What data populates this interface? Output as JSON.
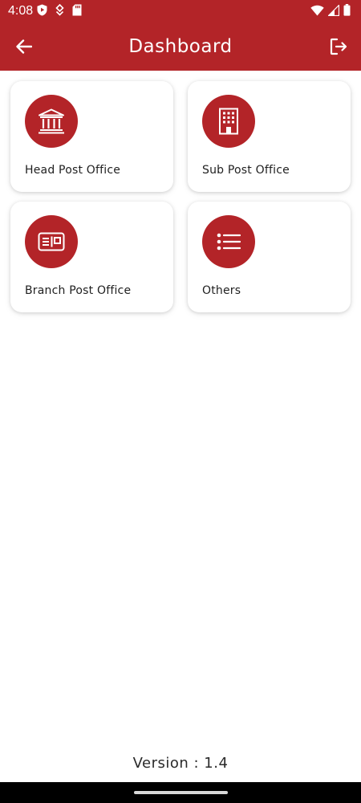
{
  "status_bar": {
    "time": "4:08",
    "icons": [
      "shield-play-icon",
      "app-notification-icon",
      "sd-card-icon",
      "wifi-icon",
      "signal-icon",
      "battery-icon"
    ]
  },
  "app_bar": {
    "title": "Dashboard",
    "back_icon": "arrow-left-icon",
    "logout_icon": "logout-icon"
  },
  "menu": {
    "items": [
      {
        "label": "Head Post Office",
        "icon": "bank-icon"
      },
      {
        "label": "Sub Post Office",
        "icon": "building-icon"
      },
      {
        "label": "Branch Post Office",
        "icon": "post-card-icon"
      },
      {
        "label": "Others",
        "icon": "list-icon"
      }
    ]
  },
  "footer": {
    "version": "Version : 1.4"
  },
  "colors": {
    "primary": "#b32428",
    "background": "#ffffff",
    "card": "#ffffff",
    "text": "#1f1f1f"
  }
}
